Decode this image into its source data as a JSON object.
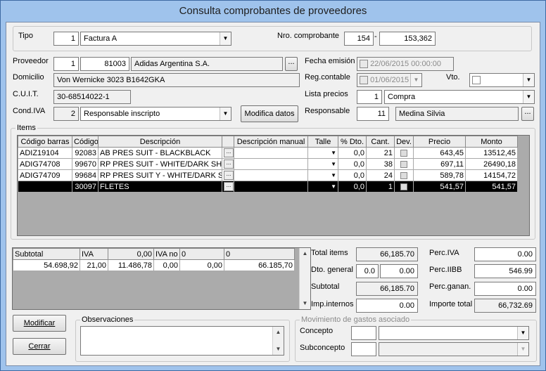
{
  "window": {
    "title": "Consulta comprobantes de proveedores"
  },
  "header": {
    "tipo_label": "Tipo",
    "tipo_code": "1",
    "tipo_value": "Factura A",
    "nro_label": "Nro. comprobante",
    "nro_prefix": "154",
    "nro_sep": "-",
    "nro_number": "153,362",
    "proveedor_label": "Proveedor",
    "proveedor_num": "1",
    "proveedor_code": "81003",
    "proveedor_name": "Adidas Argentina S.A.",
    "ellipsis": "...",
    "fecha_emision_label": "Fecha emisión",
    "fecha_emision_value": "22/06/2015 00:00:00",
    "domicilio_label": "Domicilio",
    "domicilio_value": "Von Wernicke 3023  B1642GKA",
    "reg_contable_label": "Reg.contable",
    "reg_contable_value": "01/06/2015",
    "vto_label": "Vto.",
    "cuit_label": "C.U.I.T.",
    "cuit_value": "30-68514022-1",
    "lista_precios_label": "Lista precios",
    "lista_precios_code": "1",
    "lista_precios_value": "Compra",
    "cond_iva_label": "Cond.IVA",
    "cond_iva_code": "2",
    "cond_iva_value": "Responsable inscripto",
    "modifica_datos_label": "Modifica datos",
    "responsable_label": "Responsable",
    "responsable_code": "11",
    "responsable_value": "Medina Silvia"
  },
  "items": {
    "group_label": "Items",
    "columns": [
      "Código barras",
      "Código",
      "Descripción",
      "",
      "Descripción manual",
      "Talle",
      "% Dto.",
      "Cant.",
      "Dev.",
      "Precio",
      "Monto"
    ],
    "rows": [
      {
        "barras": "ADIZ19104",
        "codigo": "92083",
        "descripcion": "AB PRES SUIT - BLACKBLACK",
        "manual": "",
        "talle": "",
        "dto": "0,0",
        "cant": "21",
        "precio": "643,45",
        "monto": "13512,45"
      },
      {
        "barras": "ADIG74708",
        "codigo": "99670",
        "descripcion": "RP PRES SUIT - WHITE/DARK SH.",
        "manual": "",
        "talle": "",
        "dto": "0,0",
        "cant": "38",
        "precio": "697,11",
        "monto": "26490,18"
      },
      {
        "barras": "ADIG74709",
        "codigo": "99684",
        "descripcion": "RP PRES SUIT Y - WHITE/DARK S",
        "manual": "",
        "talle": "",
        "dto": "0,0",
        "cant": "24",
        "precio": "589,78",
        "monto": "14154,72"
      },
      {
        "barras": "",
        "codigo": "30097",
        "descripcion": "FLETES",
        "manual": "",
        "talle": "",
        "dto": "0,0",
        "cant": "1",
        "precio": "541,57",
        "monto": "541,57"
      }
    ]
  },
  "taxes": {
    "headers": [
      "Subtotal",
      "IVA",
      "0,00",
      "IVA no",
      "0",
      "0"
    ],
    "row": [
      "54.698,92",
      "21,00",
      "11.486,78",
      "0,00",
      "0,00",
      "66.185,70"
    ]
  },
  "totals": {
    "total_items_label": "Total items",
    "total_items_value": "66,185.70",
    "dto_general_label": "Dto. general",
    "dto_general_pct": "0.0",
    "dto_general_value": "0.00",
    "subtotal_label": "Subtotal",
    "subtotal_value": "66,185.70",
    "imp_internos_label": "Imp.internos",
    "imp_internos_value": "0.00",
    "perc_iva_label": "Perc.IVA",
    "perc_iva_value": "0.00",
    "perc_iibb_label": "Perc.IIBB",
    "perc_iibb_value": "546.99",
    "perc_ganan_label": "Perc.ganan.",
    "perc_ganan_value": "0.00",
    "importe_total_label": "Importe total",
    "importe_total_value": "66,732.69"
  },
  "bottom": {
    "modificar_label": "Modificar",
    "cerrar_label": "Cerrar",
    "observaciones_label": "Observaciones",
    "movimiento_label": "Movimiento de gastos asociado",
    "concepto_label": "Concepto",
    "subconcepto_label": "Subconcepto"
  }
}
